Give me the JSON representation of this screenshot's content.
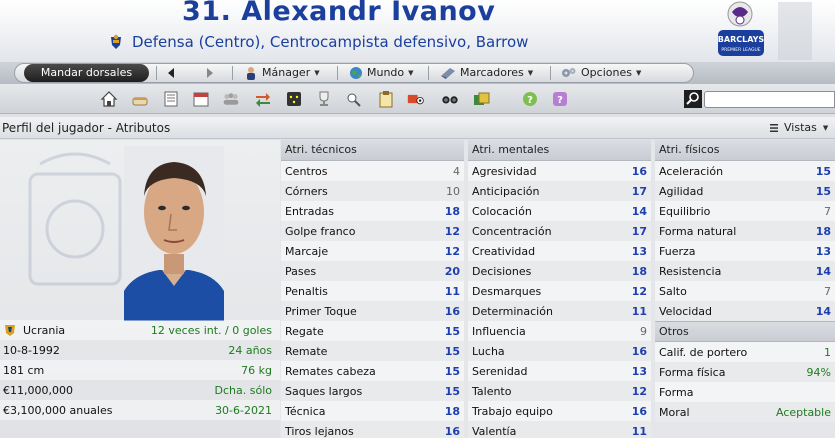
{
  "header": {
    "title": "31. Alexandr Ivanov",
    "subtitle": "Defensa (Centro), Centrocampista defensivo, Barrow",
    "league_badge_text": "BARCLAYS",
    "league_badge_sub": "PREMIER LEAGUE"
  },
  "toolbar": {
    "dorsales": "Mandar dorsales",
    "manager": "Mánager",
    "mundo": "Mundo",
    "marcadores": "Marcadores",
    "opciones": "Opciones"
  },
  "icons": [
    "home-icon",
    "cake-icon",
    "notebook-icon",
    "calendar-icon",
    "squad-icon",
    "transfer-icon",
    "tactics-icon",
    "trophy-icon",
    "scout-icon",
    "clipboard-icon",
    "training-icon",
    "binoculars-icon",
    "finance-icon",
    "help-icon",
    "question-icon"
  ],
  "section": {
    "title": "Perfil del jugador - Atributos",
    "vistas": "Vistas"
  },
  "profile": {
    "nationality": "Ucrania",
    "caps": "12 veces int. / 0 goles",
    "dob": "10-8-1992",
    "age": "24 años",
    "height": "181 cm",
    "weight": "76 kg",
    "value": "€11,000,000",
    "foot": "Dcha. sólo",
    "wage": "€3,100,000 anuales",
    "contract": "30-6-2021"
  },
  "technical": {
    "header": "Atri. técnicos",
    "rows": [
      {
        "name": "Centros",
        "value": "4",
        "tone": "grey"
      },
      {
        "name": "Córners",
        "value": "10",
        "tone": "grey"
      },
      {
        "name": "Entradas",
        "value": "18",
        "tone": "blue"
      },
      {
        "name": "Golpe franco",
        "value": "12",
        "tone": "blue"
      },
      {
        "name": "Marcaje",
        "value": "12",
        "tone": "blue"
      },
      {
        "name": "Pases",
        "value": "20",
        "tone": "blue"
      },
      {
        "name": "Penaltis",
        "value": "11",
        "tone": "blue"
      },
      {
        "name": "Primer Toque",
        "value": "16",
        "tone": "blue"
      },
      {
        "name": "Regate",
        "value": "15",
        "tone": "blue"
      },
      {
        "name": "Remate",
        "value": "15",
        "tone": "blue"
      },
      {
        "name": "Remates cabeza",
        "value": "15",
        "tone": "blue"
      },
      {
        "name": "Saques largos",
        "value": "15",
        "tone": "blue"
      },
      {
        "name": "Técnica",
        "value": "18",
        "tone": "blue"
      },
      {
        "name": "Tiros lejanos",
        "value": "16",
        "tone": "blue"
      }
    ]
  },
  "mental": {
    "header": "Atri. mentales",
    "rows": [
      {
        "name": "Agresividad",
        "value": "16",
        "tone": "blue"
      },
      {
        "name": "Anticipación",
        "value": "17",
        "tone": "blue"
      },
      {
        "name": "Colocación",
        "value": "14",
        "tone": "blue"
      },
      {
        "name": "Concentración",
        "value": "17",
        "tone": "blue"
      },
      {
        "name": "Creatividad",
        "value": "13",
        "tone": "blue"
      },
      {
        "name": "Decisiones",
        "value": "18",
        "tone": "blue"
      },
      {
        "name": "Desmarques",
        "value": "12",
        "tone": "blue"
      },
      {
        "name": "Determinación",
        "value": "11",
        "tone": "blue"
      },
      {
        "name": "Influencia",
        "value": "9",
        "tone": "grey"
      },
      {
        "name": "Lucha",
        "value": "16",
        "tone": "blue"
      },
      {
        "name": "Serenidad",
        "value": "13",
        "tone": "blue"
      },
      {
        "name": "Talento",
        "value": "12",
        "tone": "blue"
      },
      {
        "name": "Trabajo equipo",
        "value": "16",
        "tone": "blue"
      },
      {
        "name": "Valentía",
        "value": "11",
        "tone": "blue"
      }
    ]
  },
  "physical": {
    "header": "Atri. físicos",
    "rows": [
      {
        "name": "Aceleración",
        "value": "15",
        "tone": "blue"
      },
      {
        "name": "Agilidad",
        "value": "15",
        "tone": "blue"
      },
      {
        "name": "Equilibrio",
        "value": "7",
        "tone": "grey"
      },
      {
        "name": "Forma natural",
        "value": "18",
        "tone": "blue"
      },
      {
        "name": "Fuerza",
        "value": "13",
        "tone": "blue"
      },
      {
        "name": "Resistencia",
        "value": "14",
        "tone": "blue"
      },
      {
        "name": "Salto",
        "value": "7",
        "tone": "grey"
      },
      {
        "name": "Velocidad",
        "value": "14",
        "tone": "blue"
      }
    ]
  },
  "others": {
    "header": "Otros",
    "rows": [
      {
        "name": "Calif. de portero",
        "value": "1",
        "tone": "green"
      },
      {
        "name": "Forma física",
        "value": "94%",
        "tone": "green"
      },
      {
        "name": "Forma",
        "value": "",
        "tone": "green"
      },
      {
        "name": "Moral",
        "value": "Aceptable",
        "tone": "green"
      }
    ]
  }
}
